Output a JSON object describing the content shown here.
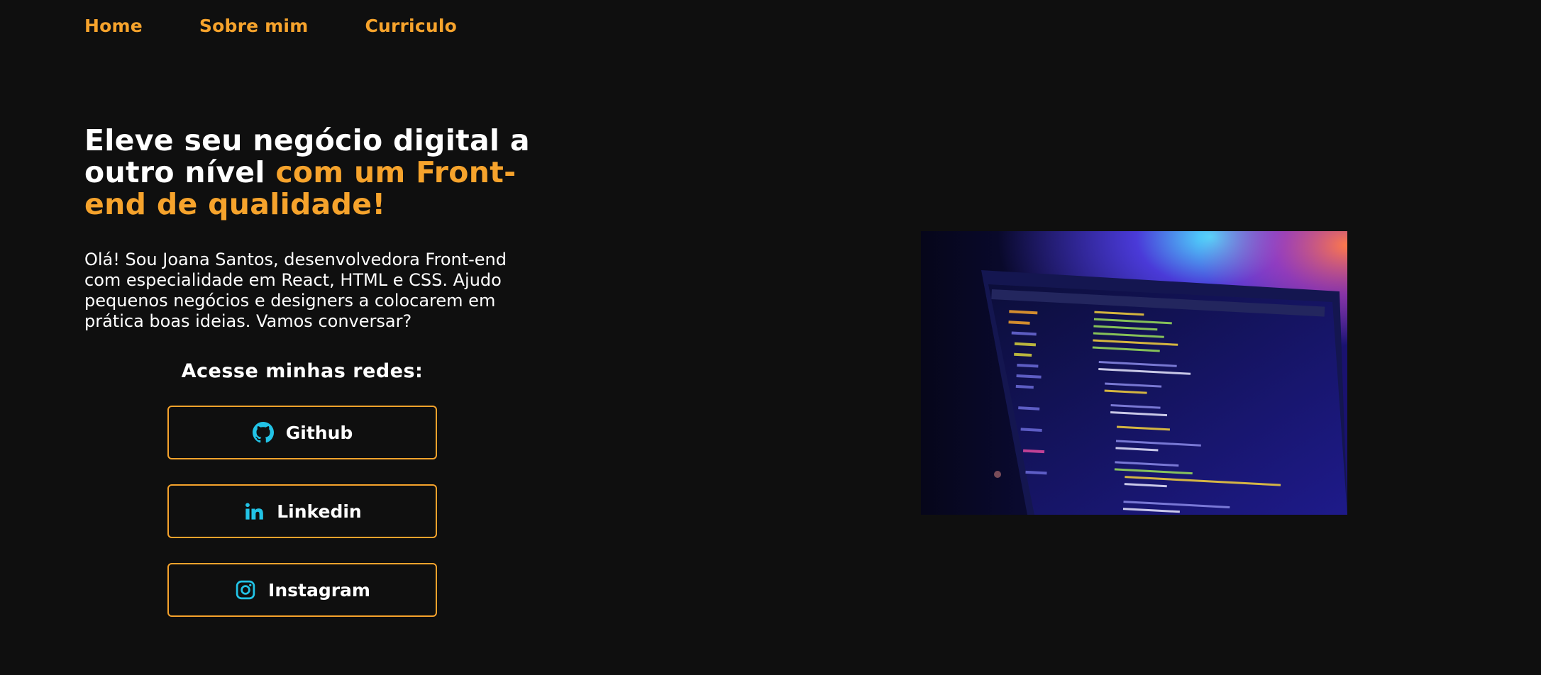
{
  "nav": {
    "items": [
      {
        "label": "Home"
      },
      {
        "label": "Sobre mim"
      },
      {
        "label": "Curriculo"
      }
    ]
  },
  "hero": {
    "title_white": "Eleve seu negócio digital a outro nível",
    "title_accent": "com um Front-end de qualidade!",
    "intro": "Olá! Sou Joana Santos, desenvolvedora Front-end com especialidade em React, HTML e CSS. Ajudo pequenos negócios e designers a colocarem em prática boas ideias. Vamos conversar?"
  },
  "social": {
    "heading": "Acesse minhas redes:",
    "buttons": [
      {
        "label": "Github",
        "icon": "github-icon"
      },
      {
        "label": "Linkedin",
        "icon": "linkedin-icon"
      },
      {
        "label": "Instagram",
        "icon": "instagram-icon"
      }
    ]
  },
  "colors": {
    "background": "#0f0f0f",
    "accent": "#f6a32c",
    "icon": "#22c3e6",
    "text": "#ffffff"
  }
}
